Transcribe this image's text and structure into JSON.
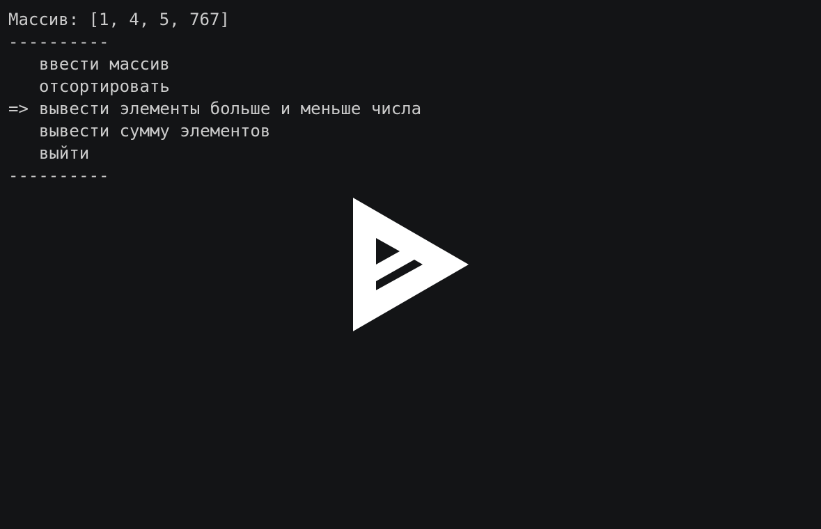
{
  "colors": {
    "background": "#131416",
    "text": "#cccccc",
    "overlay_icon": "#ffffff"
  },
  "terminal": {
    "array_line": "Массив: [1, 4, 5, 767]",
    "separator_top": "----------",
    "menu": {
      "selected_marker": "=>",
      "items": [
        {
          "label": "ввести массив",
          "selected": false
        },
        {
          "label": "отсортировать",
          "selected": false
        },
        {
          "label": "вывести элементы больше и меньше числа",
          "selected": true
        },
        {
          "label": "вывести сумму элементов",
          "selected": false
        },
        {
          "label": "выйти",
          "selected": false
        }
      ]
    },
    "separator_bottom": "----------"
  },
  "overlay": {
    "icon": "asciinema-play-icon"
  }
}
